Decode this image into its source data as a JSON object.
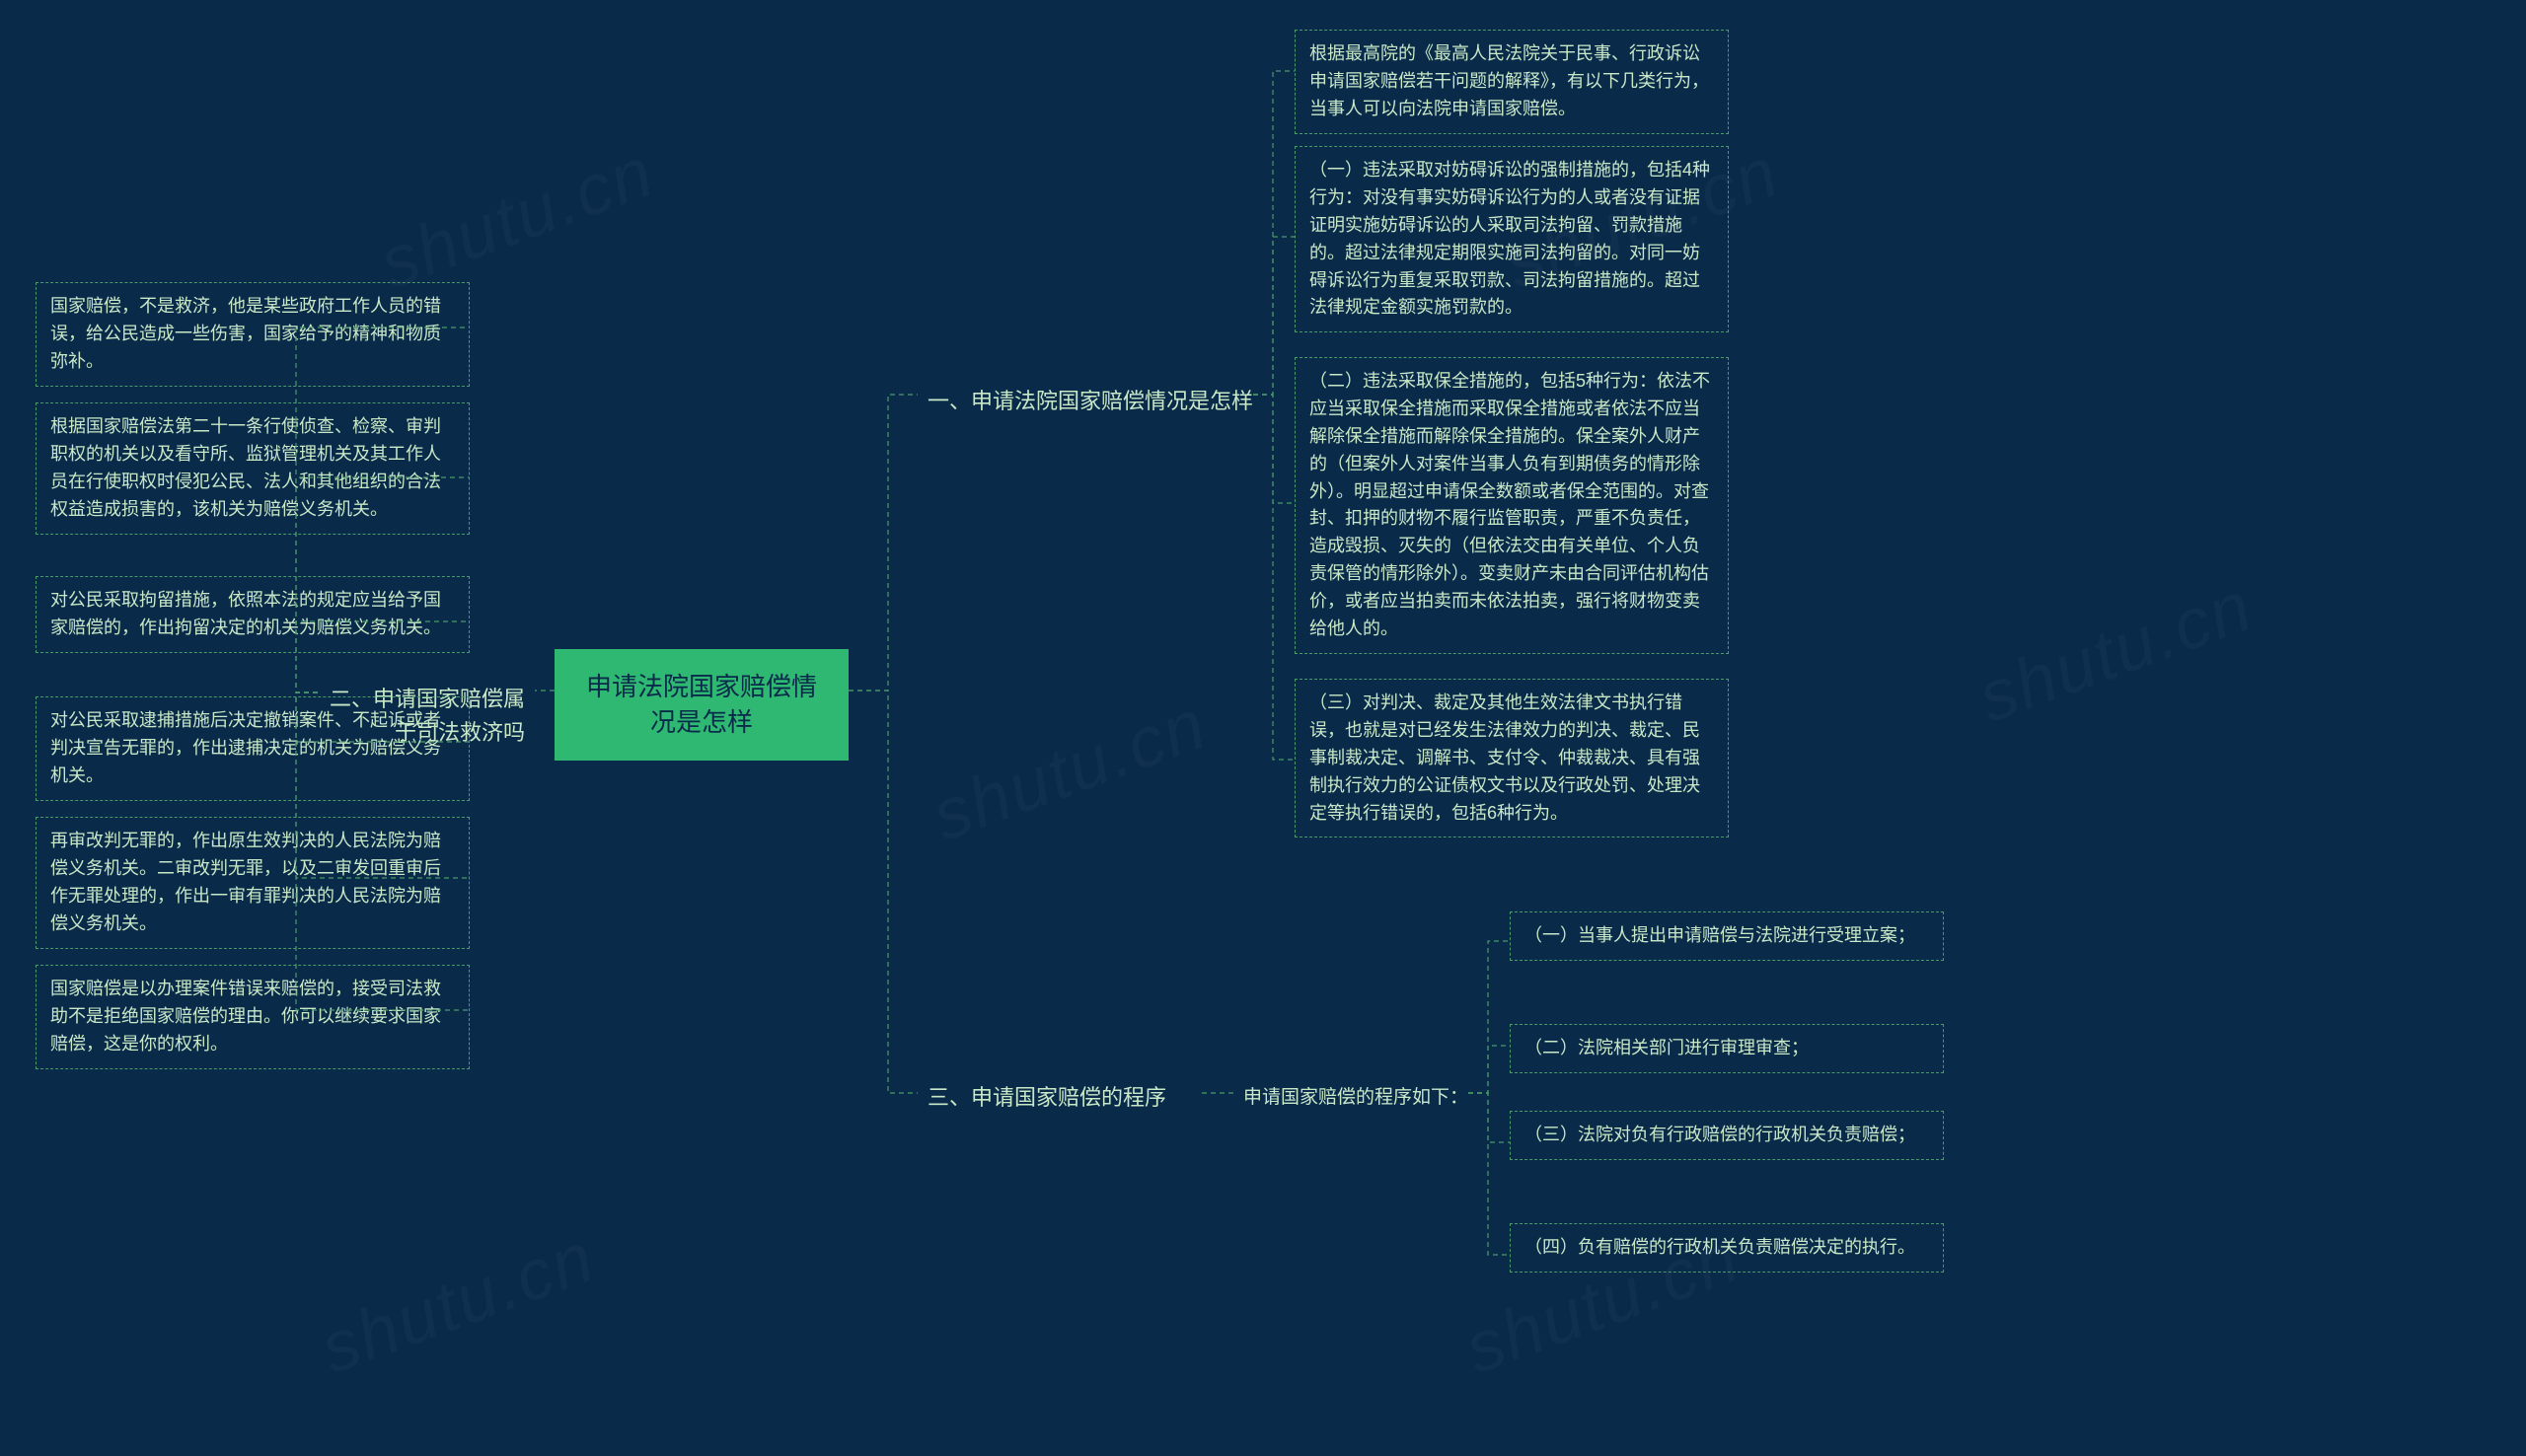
{
  "watermark": "shutu.cn",
  "center": "申请法院国家赔偿情况是怎样",
  "branch1": {
    "title": "一、申请法院国家赔偿情况是怎样",
    "items": [
      "根据最高院的《最高人民法院关于民事、行政诉讼申请国家赔偿若干问题的解释》，有以下几类行为，当事人可以向法院申请国家赔偿。",
      "（一）违法采取对妨碍诉讼的强制措施的，包括4种行为：对没有事实妨碍诉讼行为的人或者没有证据证明实施妨碍诉讼的人采取司法拘留、罚款措施的。超过法律规定期限实施司法拘留的。对同一妨碍诉讼行为重复采取罚款、司法拘留措施的。超过法律规定金额实施罚款的。",
      "（二）违法采取保全措施的，包括5种行为：依法不应当采取保全措施而采取保全措施或者依法不应当解除保全措施而解除保全措施的。保全案外人财产的（但案外人对案件当事人负有到期债务的情形除外）。明显超过申请保全数额或者保全范围的。对查封、扣押的财物不履行监管职责，严重不负责任，造成毁损、灭失的（但依法交由有关单位、个人负责保管的情形除外）。变卖财产未由合同评估机构估价，或者应当拍卖而未依法拍卖，强行将财物变卖给他人的。",
      "（三）对判决、裁定及其他生效法律文书执行错误，也就是对已经发生法律效力的判决、裁定、民事制裁决定、调解书、支付令、仲裁裁决、具有强制执行效力的公证债权文书以及行政处罚、处理决定等执行错误的，包括6种行为。"
    ]
  },
  "branch2": {
    "title": "二、申请国家赔偿属于司法救济吗",
    "items": [
      "国家赔偿，不是救济，他是某些政府工作人员的错误，给公民造成一些伤害，国家给予的精神和物质弥补。",
      "根据国家赔偿法第二十一条行使侦查、检察、审判职权的机关以及看守所、监狱管理机关及其工作人员在行使职权时侵犯公民、法人和其他组织的合法权益造成损害的，该机关为赔偿义务机关。",
      "对公民采取拘留措施，依照本法的规定应当给予国家赔偿的，作出拘留决定的机关为赔偿义务机关。",
      "对公民采取逮捕措施后决定撤销案件、不起诉或者判决宣告无罪的，作出逮捕决定的机关为赔偿义务机关。",
      "再审改判无罪的，作出原生效判决的人民法院为赔偿义务机关。二审改判无罪，以及二审发回重审后作无罪处理的，作出一审有罪判决的人民法院为赔偿义务机关。",
      "国家赔偿是以办理案件错误来赔偿的，接受司法救助不是拒绝国家赔偿的理由。你可以继续要求国家赔偿，这是你的权利。"
    ]
  },
  "branch3": {
    "title": "三、申请国家赔偿的程序",
    "sub": "申请国家赔偿的程序如下：",
    "items": [
      "（一）当事人提出申请赔偿与法院进行受理立案；",
      "（二）法院相关部门进行审理审查；",
      "（三）法院对负有行政赔偿的行政机关负责赔偿；",
      "（四）负有赔偿的行政机关负责赔偿决定的执行。"
    ]
  }
}
